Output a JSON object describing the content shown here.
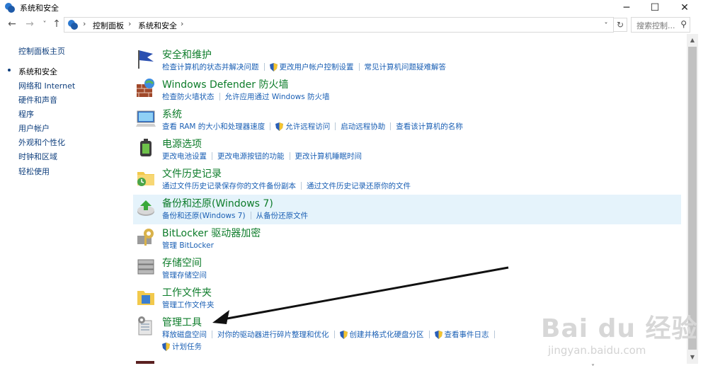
{
  "window": {
    "title": "系统和安全",
    "minimize": "─",
    "maximize": "☐",
    "close": "✕"
  },
  "nav": {
    "back": "←",
    "forward": "→",
    "recent": "˅",
    "up": "↑",
    "breadcrumbs": [
      "控制面板",
      "系统和安全"
    ],
    "search_placeholder": "搜索控制..."
  },
  "sidebar": {
    "items": [
      {
        "label": "控制面板主页"
      },
      {
        "label": "系统和安全"
      },
      {
        "label": "网络和 Internet"
      },
      {
        "label": "硬件和声音"
      },
      {
        "label": "程序"
      },
      {
        "label": "用户帐户"
      },
      {
        "label": "外观和个性化"
      },
      {
        "label": "时钟和区域"
      },
      {
        "label": "轻松使用"
      }
    ]
  },
  "categories": [
    {
      "title": "安全和维护",
      "icon": "flag-icon",
      "links": [
        {
          "text": "检查计算机的状态并解决问题"
        },
        {
          "text": "更改用户帐户控制设置",
          "shield": true
        },
        {
          "text": "常见计算机问题疑难解答"
        }
      ]
    },
    {
      "title": "Windows Defender 防火墙",
      "icon": "firewall-icon",
      "links": [
        {
          "text": "检查防火墙状态"
        },
        {
          "text": "允许应用通过 Windows 防火墙"
        }
      ]
    },
    {
      "title": "系统",
      "icon": "system-icon",
      "links": [
        {
          "text": "查看 RAM 的大小和处理器速度"
        },
        {
          "text": "允许远程访问",
          "shield": true
        },
        {
          "text": "启动远程协助"
        },
        {
          "text": "查看该计算机的名称"
        }
      ]
    },
    {
      "title": "电源选项",
      "icon": "power-icon",
      "links": [
        {
          "text": "更改电池设置"
        },
        {
          "text": "更改电源按钮的功能"
        },
        {
          "text": "更改计算机睡眠时间"
        }
      ]
    },
    {
      "title": "文件历史记录",
      "icon": "file-history-icon",
      "links": [
        {
          "text": "通过文件历史记录保存你的文件备份副本"
        },
        {
          "text": "通过文件历史记录还原你的文件"
        }
      ]
    },
    {
      "title": "备份和还原(Windows 7)",
      "icon": "backup-icon",
      "links": [
        {
          "text": "备份和还原(Windows 7)"
        },
        {
          "text": "从备份还原文件"
        }
      ]
    },
    {
      "title": "BitLocker 驱动器加密",
      "icon": "bitlocker-icon",
      "links": [
        {
          "text": "管理 BitLocker"
        }
      ]
    },
    {
      "title": "存储空间",
      "icon": "storage-icon",
      "links": [
        {
          "text": "管理存储空间"
        }
      ]
    },
    {
      "title": "工作文件夹",
      "icon": "work-folders-icon",
      "links": [
        {
          "text": "管理工作文件夹"
        }
      ]
    },
    {
      "title": "管理工具",
      "icon": "admin-tools-icon",
      "links": [
        {
          "text": "释放磁盘空间"
        },
        {
          "text": "对你的驱动器进行碎片整理和优化"
        },
        {
          "text": "创建并格式化硬盘分区",
          "shield": true
        },
        {
          "text": "查看事件日志",
          "shield": true
        }
      ],
      "links2": [
        {
          "text": "计划任务",
          "shield": true
        }
      ]
    }
  ],
  "watermark": {
    "brand": "Bai du 经验",
    "url": "jingyan.baidu.com"
  },
  "colors": {
    "link": "#1a5fb4",
    "category_title": "#0d7c2a",
    "highlight": "#e5f3fb"
  }
}
